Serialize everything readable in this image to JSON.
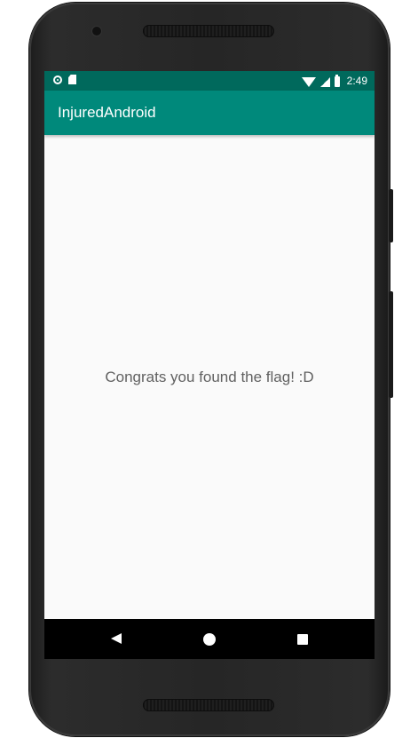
{
  "status_bar": {
    "time": "2:49",
    "left_icons": [
      "notification-circle-icon",
      "sd-card-icon"
    ],
    "right_icons": [
      "wifi-icon",
      "cell-signal-icon",
      "battery-icon"
    ],
    "color": "#00695c"
  },
  "app_bar": {
    "title": "InjuredAndroid",
    "color": "#00897b"
  },
  "content": {
    "message": "Congrats you found the flag! :D",
    "background": "#fafafa"
  },
  "nav_bar": {
    "buttons": [
      "back-icon",
      "home-icon",
      "recents-icon"
    ]
  }
}
